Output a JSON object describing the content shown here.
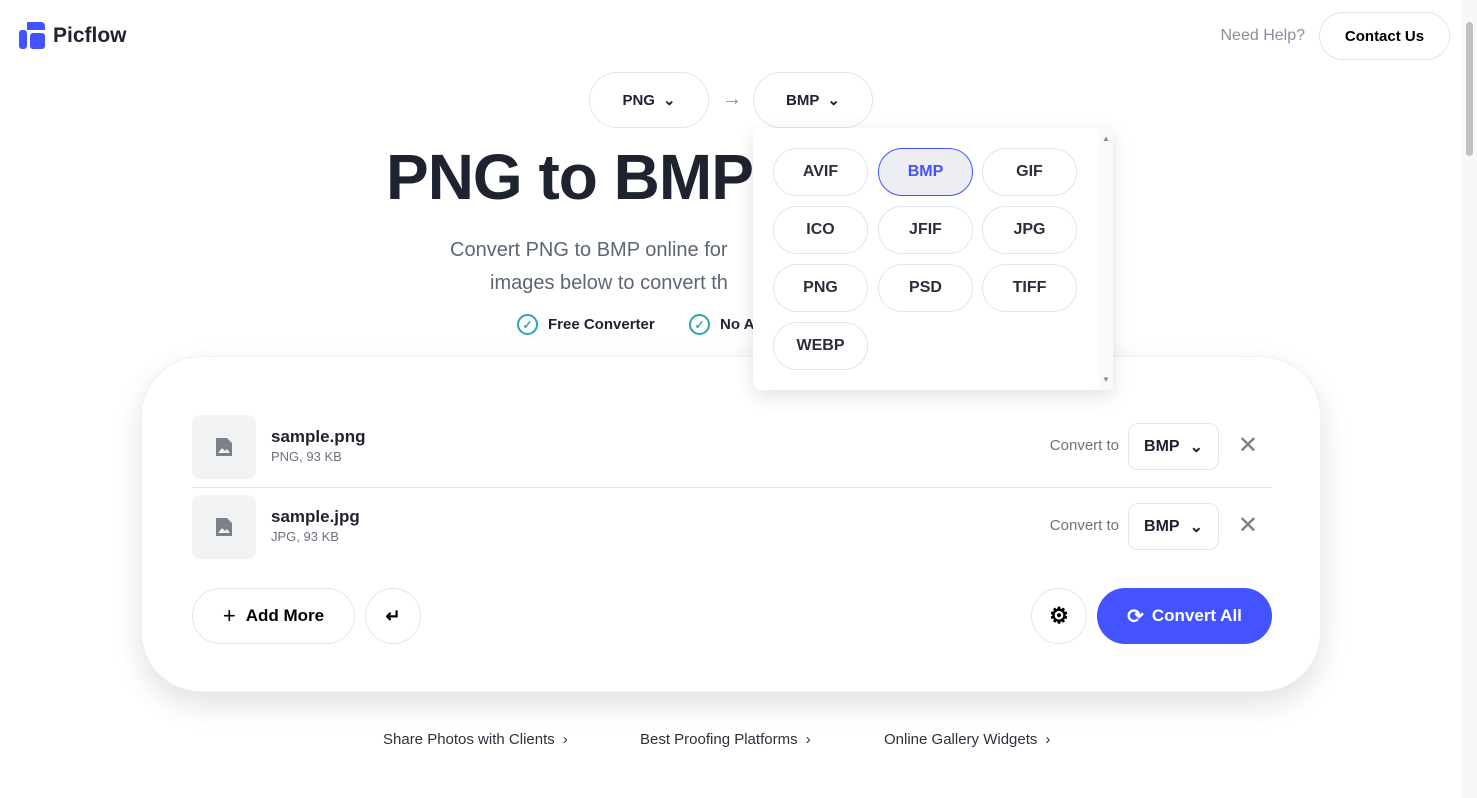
{
  "brand": {
    "name": "Picflow",
    "accent": "#4353ff"
  },
  "header": {
    "help": "Need Help?",
    "contact": "Contact Us"
  },
  "format_picker": {
    "from": "PNG",
    "to": "BMP"
  },
  "hero": {
    "title": "PNG to BMP",
    "subtitle_line1": "Convert PNG to BMP online for",
    "subtitle_line2": "images below to convert th",
    "features": [
      "Free Converter",
      "No A"
    ]
  },
  "dropdown": {
    "options": [
      "AVIF",
      "BMP",
      "GIF",
      "ICO",
      "JFIF",
      "JPG",
      "PNG",
      "PSD",
      "TIFF",
      "WEBP"
    ],
    "selected": "BMP"
  },
  "files": [
    {
      "name": "sample.png",
      "meta": "PNG, 93 KB",
      "convert_label": "Convert to",
      "target": "BMP"
    },
    {
      "name": "sample.jpg",
      "meta": "JPG, 93 KB",
      "convert_label": "Convert to",
      "target": "BMP"
    }
  ],
  "actions": {
    "add_more": "Add More",
    "convert_all": "Convert All"
  },
  "footer_links": [
    "Share Photos with Clients",
    "Best Proofing Platforms",
    "Online Gallery Widgets"
  ]
}
